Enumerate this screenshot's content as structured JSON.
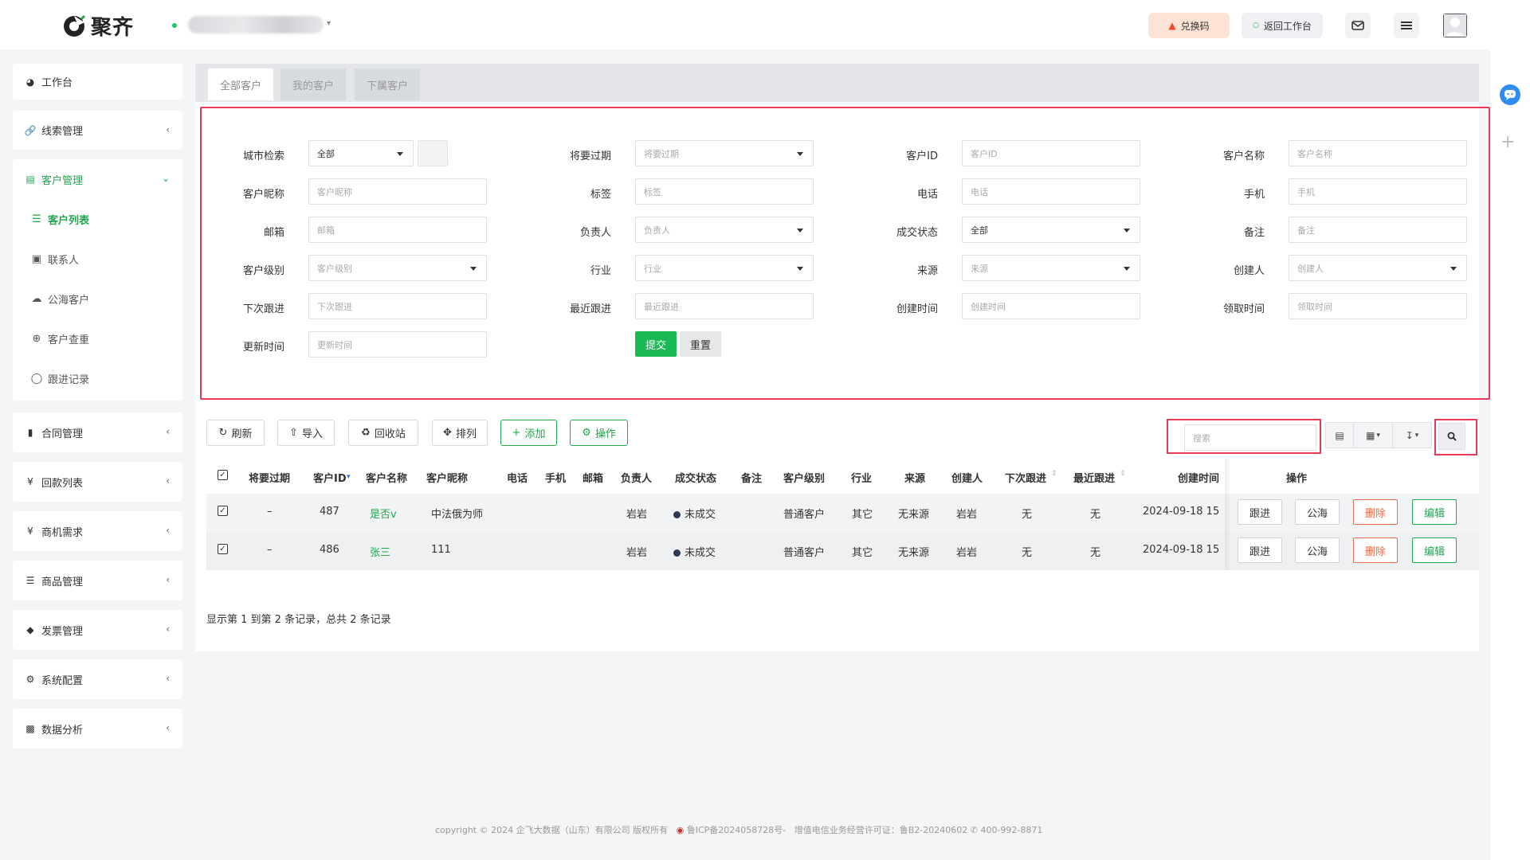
{
  "header": {
    "brand": "聚齐",
    "redeem_label": "兑换码",
    "back_label": "返回工作台"
  },
  "sidebar": {
    "workbench": "工作台",
    "leads": "线索管理",
    "customers": "客户管理",
    "customer_sub": [
      "客户列表",
      "联系人",
      "公海客户",
      "客户查重",
      "跟进记录"
    ],
    "contracts": "合同管理",
    "payments": "回款列表",
    "opportunities": "商机需求",
    "products": "商品管理",
    "invoices": "发票管理",
    "settings": "系统配置",
    "analytics": "数据分析"
  },
  "tabs": [
    "全部客户",
    "我的客户",
    "下属客户"
  ],
  "filters": {
    "city_label": "城市检索",
    "city_value": "全部",
    "expiring_label": "将要过期",
    "expiring_placeholder": "将要过期",
    "cid_label": "客户ID",
    "cid_placeholder": "客户ID",
    "cname_label": "客户名称",
    "cname_placeholder": "客户名称",
    "nick_label": "客户昵称",
    "nick_placeholder": "客户昵称",
    "tag_label": "标签",
    "tag_placeholder": "标签",
    "phone_label": "电话",
    "phone_placeholder": "电话",
    "mobile_label": "手机",
    "mobile_placeholder": "手机",
    "email_label": "邮箱",
    "email_placeholder": "邮箱",
    "owner_label": "负责人",
    "owner_placeholder": "负责人",
    "deal_label": "成交状态",
    "deal_value": "全部",
    "remark_label": "备注",
    "remark_placeholder": "备注",
    "level_label": "客户级别",
    "level_placeholder": "客户级别",
    "industry_label": "行业",
    "industry_placeholder": "行业",
    "source_label": "来源",
    "source_placeholder": "来源",
    "creator_label": "创建人",
    "creator_placeholder": "创建人",
    "next_label": "下次跟进",
    "next_placeholder": "下次跟进",
    "recent_label": "最近跟进",
    "recent_placeholder": "最近跟进",
    "created_label": "创建时间",
    "created_placeholder": "创建时间",
    "claimed_label": "领取时间",
    "claimed_placeholder": "领取时间",
    "updated_label": "更新时间",
    "updated_placeholder": "更新时间",
    "submit": "提交",
    "reset": "重置"
  },
  "toolbar": {
    "refresh": "刷新",
    "import": "导入",
    "recycle": "回收站",
    "columns": "排列",
    "add": "添加",
    "actions": "操作",
    "search_placeholder": "搜索"
  },
  "table": {
    "columns": [
      "将要过期",
      "客户ID",
      "客户名称",
      "客户昵称",
      "电话",
      "手机",
      "邮箱",
      "负责人",
      "成交状态",
      "备注",
      "客户级别",
      "行业",
      "来源",
      "创建人",
      "下次跟进",
      "最近跟进",
      "创建时间",
      "操作"
    ],
    "rows": [
      {
        "expiring": "–",
        "id": "487",
        "name": "是否v",
        "nick": "中法俄为师",
        "owner": "岩岩",
        "status": "未成交",
        "level": "普通客户",
        "industry": "其它",
        "source": "无来源",
        "creator": "岩岩",
        "next": "无",
        "recent": "无",
        "created": "2024-09-18 15"
      },
      {
        "expiring": "–",
        "id": "486",
        "name": "张三",
        "nick": "111",
        "owner": "岩岩",
        "status": "未成交",
        "level": "普通客户",
        "industry": "其它",
        "source": "无来源",
        "creator": "岩岩",
        "next": "无",
        "recent": "无",
        "created": "2024-09-18 15"
      }
    ],
    "op_follow": "跟进",
    "op_public": "公海",
    "op_delete": "删除",
    "op_edit": "编辑"
  },
  "pager_text": "显示第 1 到第 2 条记录，总共 2 条记录",
  "footer": {
    "copyright": "copyright © 2024 企飞大数据（山东）有限公司 版权所有",
    "icp": "鲁ICP备2024058728号-",
    "license": "增值电信业务经营许可证：鲁B2-20240602",
    "phone": "400-992-8871"
  }
}
